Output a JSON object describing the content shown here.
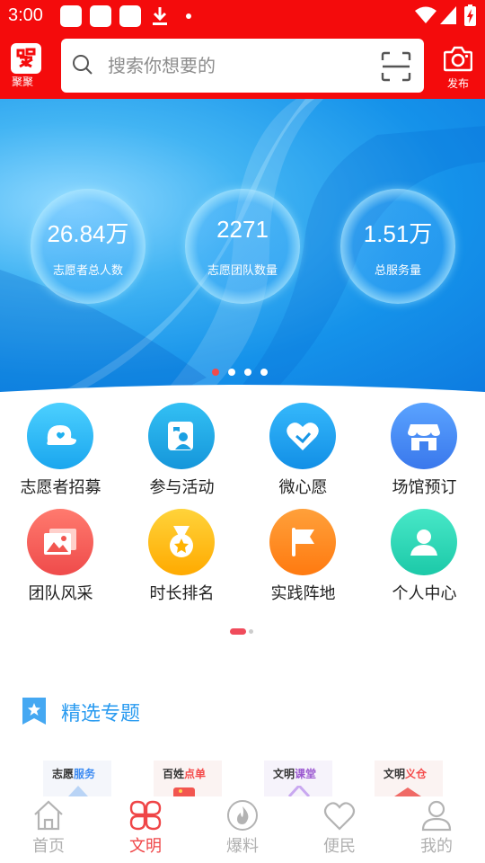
{
  "status_bar": {
    "time": "3:00",
    "icons": [
      "notification-icon",
      "notification-icon",
      "notification-icon",
      "download-icon",
      "dot-icon",
      "wifi-icon",
      "signal-icon",
      "battery-icon"
    ]
  },
  "header": {
    "logo_label": "聚聚",
    "search_placeholder": "搜索你想要的",
    "publish_label": "发布",
    "accent_color": "#f40b0c"
  },
  "banner": {
    "stats": [
      {
        "value": "26.84万",
        "label": "志愿者总人数"
      },
      {
        "value": "2271",
        "label": "志愿团队数量"
      },
      {
        "value": "1.51万",
        "label": "总服务量"
      }
    ],
    "slide_count": 4,
    "active_slide": 1
  },
  "grid": {
    "items": [
      {
        "label": "志愿者招募",
        "icon": "cap-icon",
        "color": "#29b6f6"
      },
      {
        "label": "参与活动",
        "icon": "activity-icon",
        "color": "#1fa5e0"
      },
      {
        "label": "微心愿",
        "icon": "heart-hand-icon",
        "color": "#17a7f2"
      },
      {
        "label": "场馆预订",
        "icon": "store-icon",
        "color": "#3d8bf2"
      },
      {
        "label": "团队风采",
        "icon": "photo-icon",
        "color": "#f45b5b"
      },
      {
        "label": "时长排名",
        "icon": "medal-icon",
        "color": "#ffbf00"
      },
      {
        "label": "实践阵地",
        "icon": "flag-icon",
        "color": "#ff8a1f"
      },
      {
        "label": "个人中心",
        "icon": "person-icon",
        "color": "#26d7b6"
      }
    ]
  },
  "section": {
    "title": "精选专题",
    "topics": [
      {
        "text_a": "志愿",
        "text_b": "服务",
        "color_b": "#3d8bf2"
      },
      {
        "text_a": "百姓",
        "text_b": "点单",
        "color_b": "#f44b4b"
      },
      {
        "text_a": "文明",
        "text_b": "课堂",
        "color_b": "#9b59d0"
      },
      {
        "text_a": "文明",
        "text_b": "义仓",
        "color_b": "#f44b4b"
      }
    ]
  },
  "bottom_nav": {
    "items": [
      {
        "label": "首页",
        "icon": "home-icon",
        "active": false
      },
      {
        "label": "文明",
        "icon": "clover-icon",
        "active": true
      },
      {
        "label": "爆料",
        "icon": "flame-icon",
        "active": false
      },
      {
        "label": "便民",
        "icon": "heart-icon",
        "active": false
      },
      {
        "label": "我的",
        "icon": "user-icon",
        "active": false
      }
    ],
    "active_color": "#ef4547",
    "inactive_color": "#b0b0b0"
  }
}
